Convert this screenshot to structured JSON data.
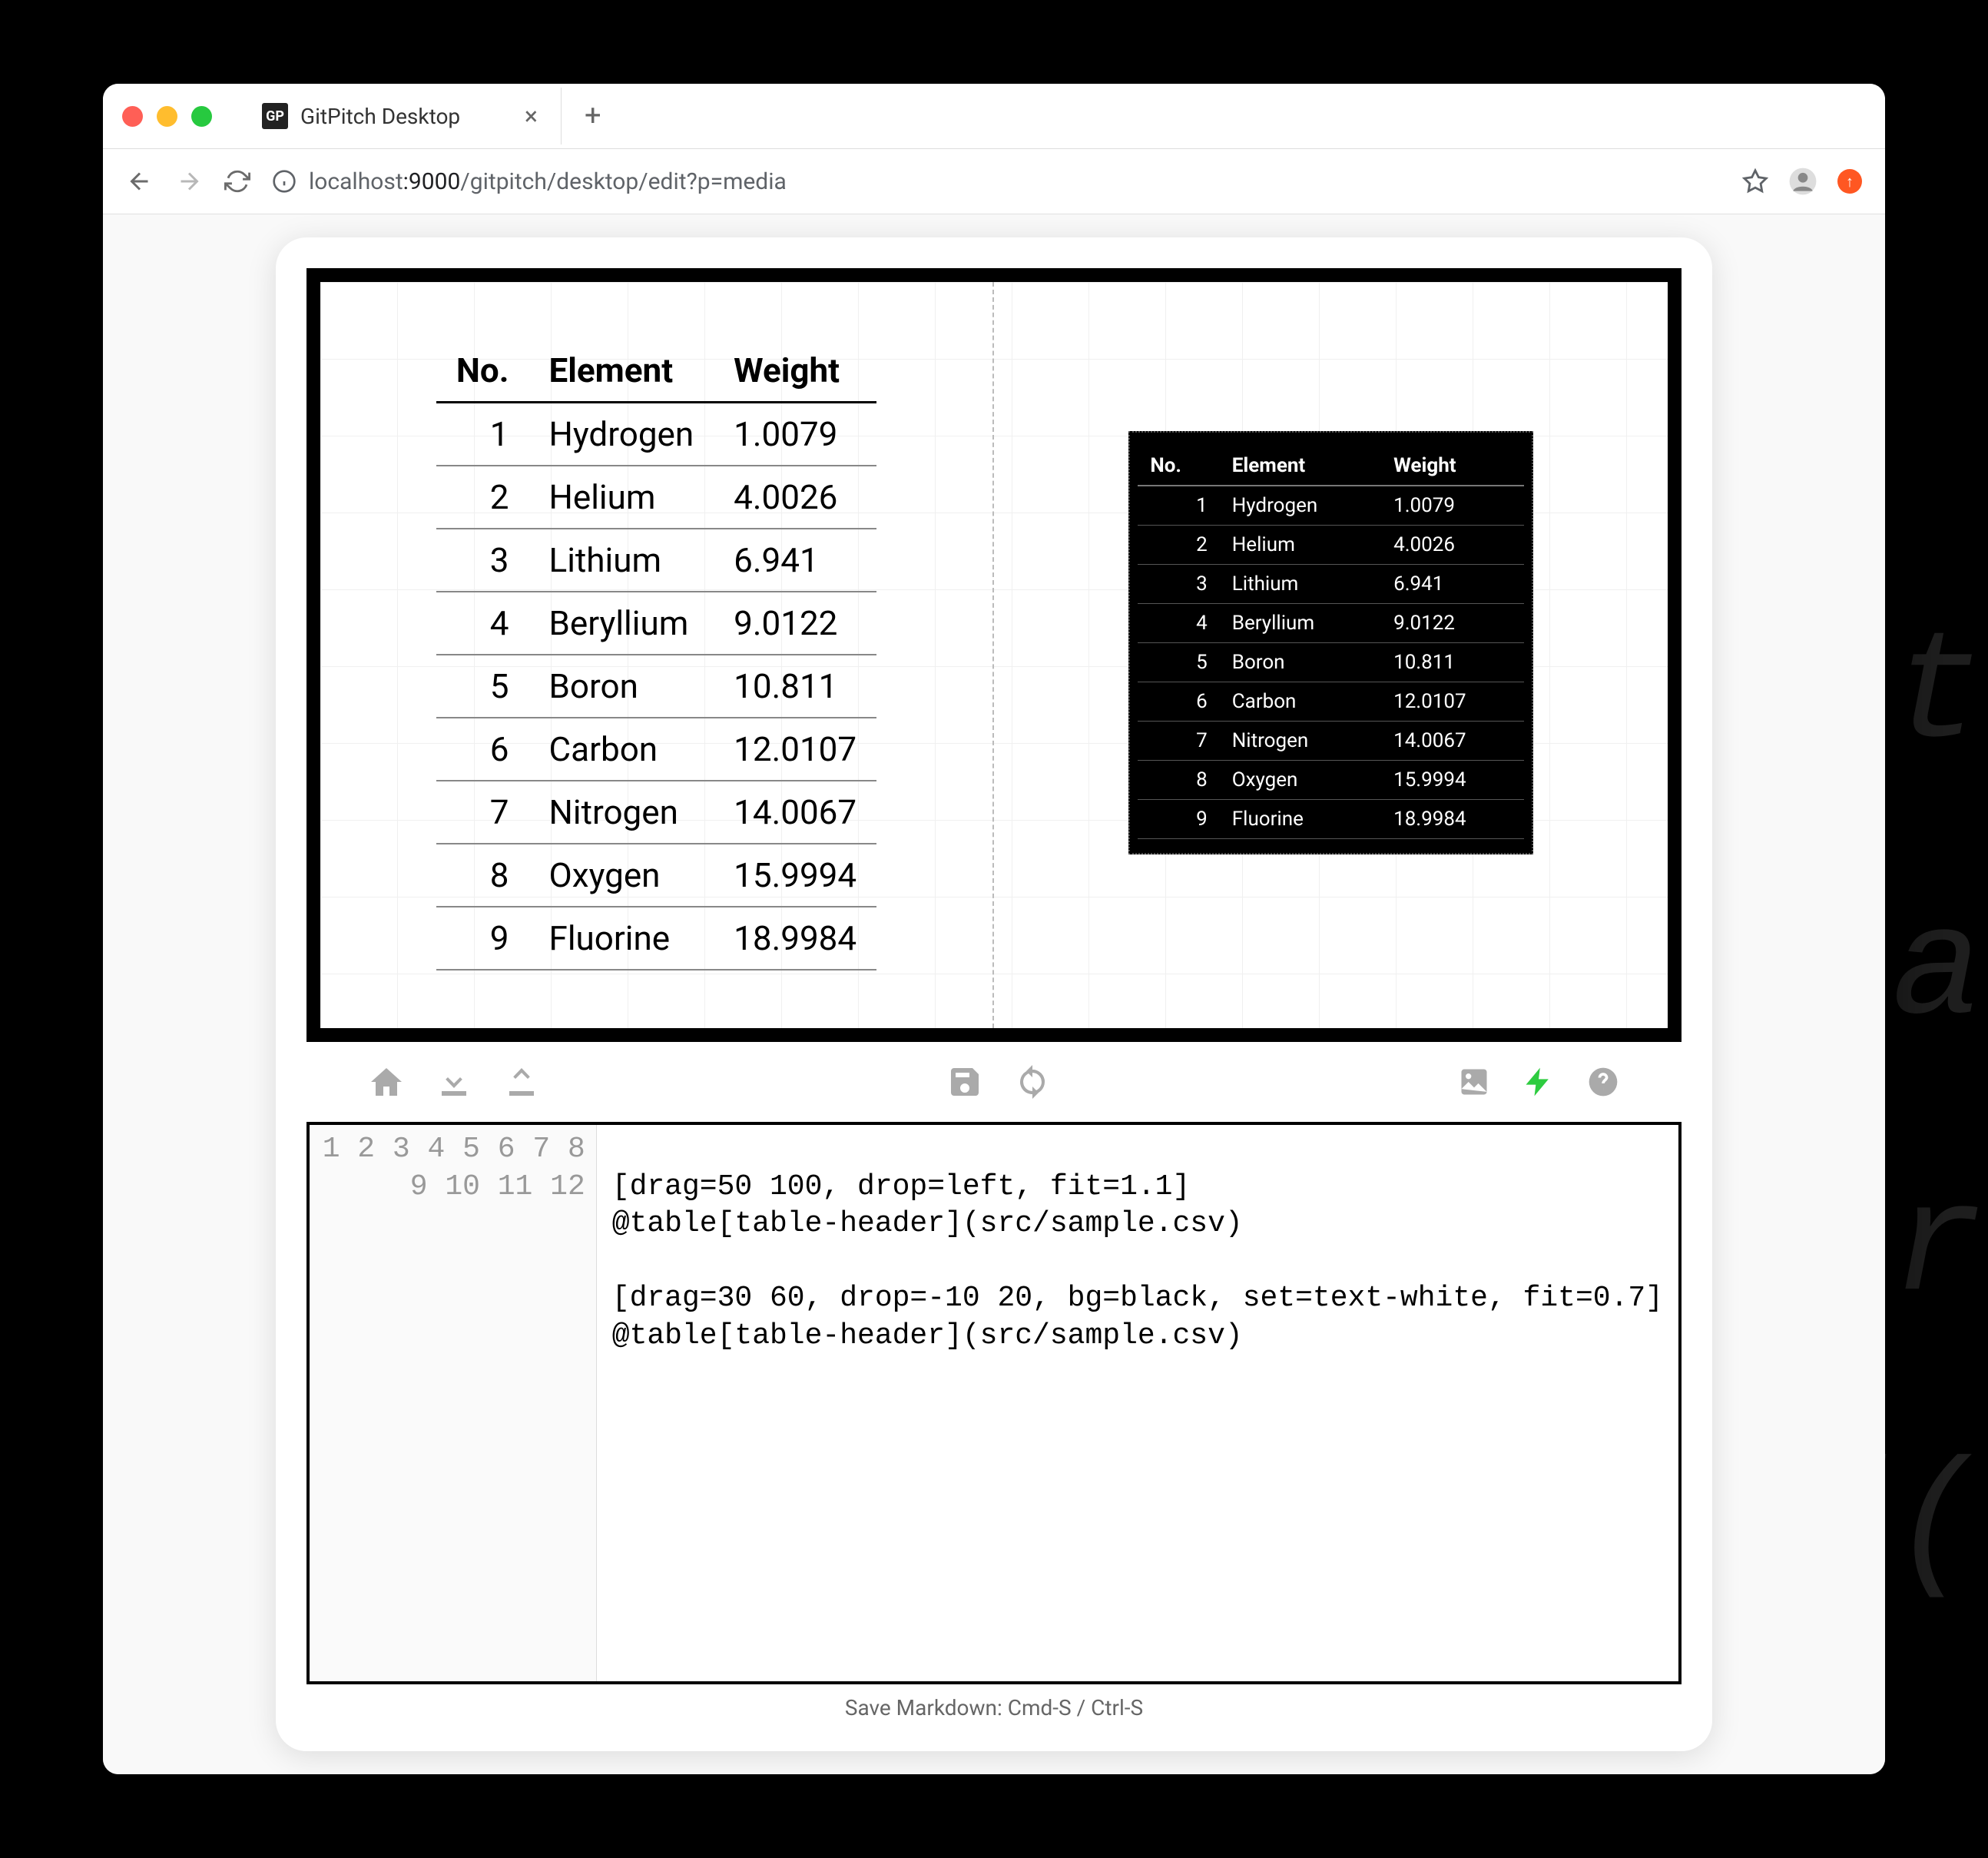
{
  "browser": {
    "tab_title": "GitPitch Desktop",
    "url_host": "localhost",
    "url_port": ":9000",
    "url_path": "/gitpitch/desktop/edit?p=media",
    "favicon_text": "GP"
  },
  "table": {
    "headers": [
      "No.",
      "Element",
      "Weight"
    ],
    "rows": [
      {
        "no": "1",
        "element": "Hydrogen",
        "weight": "1.0079"
      },
      {
        "no": "2",
        "element": "Helium",
        "weight": "4.0026"
      },
      {
        "no": "3",
        "element": "Lithium",
        "weight": "6.941"
      },
      {
        "no": "4",
        "element": "Beryllium",
        "weight": "9.0122"
      },
      {
        "no": "5",
        "element": "Boron",
        "weight": "10.811"
      },
      {
        "no": "6",
        "element": "Carbon",
        "weight": "12.0107"
      },
      {
        "no": "7",
        "element": "Nitrogen",
        "weight": "14.0067"
      },
      {
        "no": "8",
        "element": "Oxygen",
        "weight": "15.9994"
      },
      {
        "no": "9",
        "element": "Fluorine",
        "weight": "18.9984"
      }
    ]
  },
  "editor": {
    "lines": [
      "",
      "[drag=50 100, drop=left, fit=1.1]",
      "@table[table-header](src/sample.csv)",
      "",
      "[drag=30 60, drop=-10 20, bg=black, set=text-white, fit=0.7]",
      "@table[table-header](src/sample.csv)",
      "",
      "",
      "",
      "",
      "",
      ""
    ]
  },
  "status_text": "Save Markdown: Cmd-S / Ctrl-S",
  "ghost": {
    "l1": "et",
    "l2": "pa",
    "l3": "ar",
    "l4": "d("
  }
}
